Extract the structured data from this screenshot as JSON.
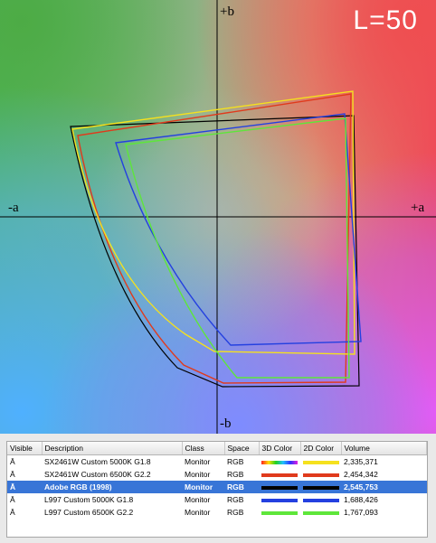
{
  "plot": {
    "axes": {
      "plus_b": "+b",
      "minus_b": "-b",
      "minus_a": "-a",
      "plus_a": "+a"
    },
    "lightness": "L=50"
  },
  "table": {
    "columns": [
      "Visible",
      "Description",
      "Class",
      "Space",
      "3D Color",
      "2D Color",
      "Volume"
    ],
    "rows": [
      {
        "visible": "Ā",
        "description": "SX2461W Custom 5000K G1.8",
        "class": "Monitor",
        "space": "RGB",
        "color3d": "rainbow",
        "color2d": "#f5e11e",
        "volume": "2,335,371",
        "selected": false
      },
      {
        "visible": "Ā",
        "description": "SX2461W Custom 6500K G2.2",
        "class": "Monitor",
        "space": "RGB",
        "color3d": "#e03a1c",
        "color2d": "#e03a1c",
        "volume": "2,454,342",
        "selected": false
      },
      {
        "visible": "Ā",
        "description": "Adobe RGB (1998)",
        "class": "Monitor",
        "space": "RGB",
        "color3d": "#000000",
        "color2d": "#000000",
        "volume": "2,545,753",
        "selected": true
      },
      {
        "visible": "Ā",
        "description": "L997 Custom 5000K G1.8",
        "class": "Monitor",
        "space": "RGB",
        "color3d": "#2440e0",
        "color2d": "#2440e0",
        "volume": "1,688,426",
        "selected": false
      },
      {
        "visible": "Ā",
        "description": "L997 Custom 6500K G2.2",
        "class": "Monitor",
        "space": "RGB",
        "color3d": "#5ee63a",
        "color2d": "#5ee63a",
        "volume": "1,767,093",
        "selected": false
      }
    ]
  },
  "colors": {
    "adobe_rgb": "#000000",
    "sx_6500": "#e03a1c",
    "sx_5000": "#f5e11e",
    "l997_5000": "#2440e0",
    "l997_6500": "#5ee63a",
    "selection": "#3875d7"
  }
}
